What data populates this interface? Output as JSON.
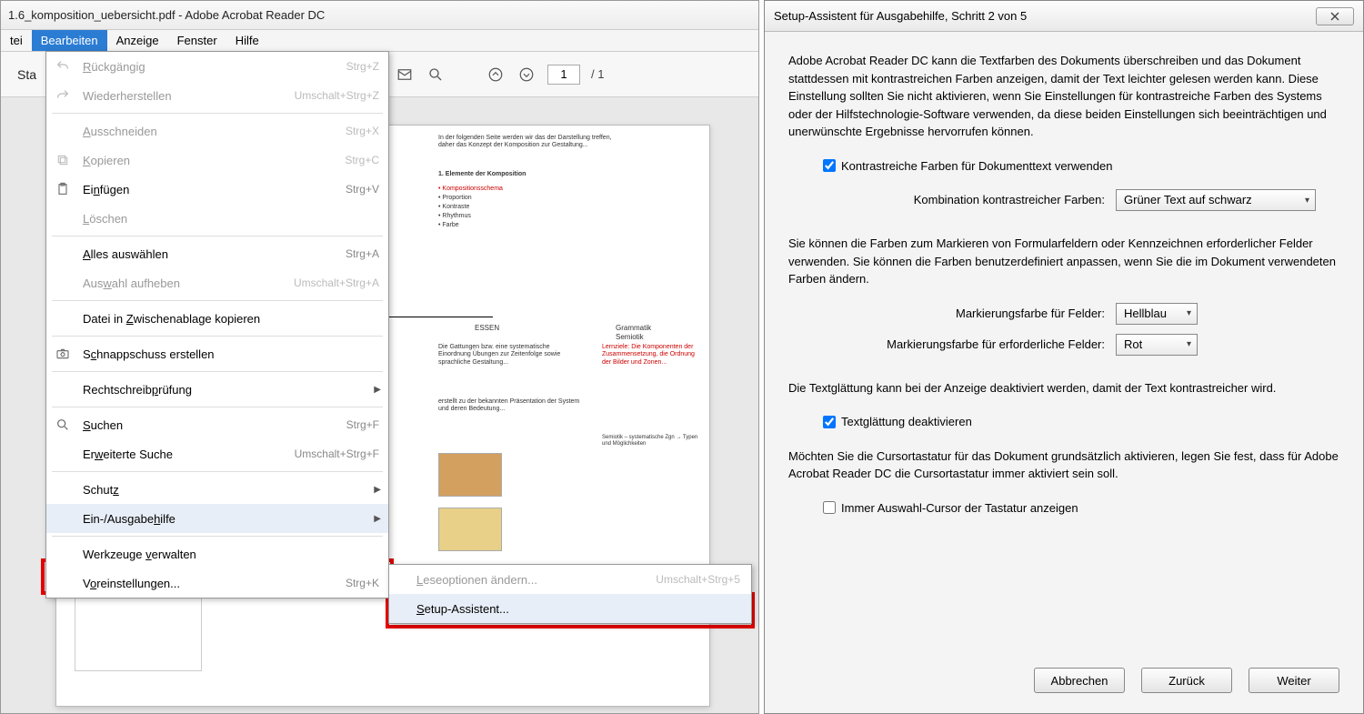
{
  "left": {
    "title": "1.6_komposition_uebersicht.pdf - Adobe Acrobat Reader DC",
    "menubar": {
      "file": "tei",
      "edit": "Bearbeiten",
      "view": "Anzeige",
      "window": "Fenster",
      "help": "Hilfe"
    },
    "toolbar": {
      "start_tab": "Sta",
      "page_value": "1",
      "page_total": "/ 1"
    },
    "dropdown": {
      "undo": "Rückgängig",
      "undo_sc": "Strg+Z",
      "redo": "Wiederherstellen",
      "redo_sc": "Umschalt+Strg+Z",
      "cut": "Ausschneiden",
      "cut_sc": "Strg+X",
      "copy": "Kopieren",
      "copy_sc": "Strg+C",
      "paste": "Einfügen",
      "paste_sc": "Strg+V",
      "delete": "Löschen",
      "selectall": "Alles auswählen",
      "selectall_sc": "Strg+A",
      "deselect": "Auswahl aufheben",
      "deselect_sc": "Umschalt+Strg+A",
      "copyclip": "Datei in Zwischenablage kopieren",
      "snapshot": "Schnappschuss erstellen",
      "spell": "Rechtschreibprüfung",
      "search": "Suchen",
      "search_sc": "Strg+F",
      "advsearch": "Erweiterte Suche",
      "advsearch_sc": "Umschalt+Strg+F",
      "protect": "Schutz",
      "accessibility": "Ein-/Ausgabehilfe",
      "tools": "Werkzeuge verwalten",
      "prefs": "Voreinstellungen...",
      "prefs_sc": "Strg+K"
    },
    "submenu": {
      "readopts": "Leseoptionen ändern...",
      "readopts_sc": "Umschalt+Strg+5",
      "setup": "Setup-Assistent..."
    }
  },
  "dialog": {
    "title": "Setup-Assistent für Ausgabehilfe, Schritt 2 von 5",
    "para1": "Adobe Acrobat Reader DC kann die Textfarben des Dokuments überschreiben und das Dokument stattdessen mit kontrastreichen Farben anzeigen, damit der Text leichter gelesen werden kann. Diese Einstellung sollten Sie nicht aktivieren, wenn Sie Einstellungen für kontrastreiche Farben des Systems oder der Hilfstechnologie-Software verwenden, da diese beiden Einstellungen sich beeinträchtigen und unerwünschte Ergebnisse hervorrufen können.",
    "check1": "Kontrastreiche Farben für Dokumenttext verwenden",
    "combo1_label": "Kombination kontrastreicher Farben:",
    "combo1_value": "Grüner Text auf schwarz",
    "para2": "Sie können die Farben zum Markieren von Formularfeldern oder Kennzeichnen erforderlicher Felder verwenden. Sie können die Farben benutzerdefiniert anpassen, wenn Sie die im Dokument verwendeten Farben ändern.",
    "field2_label": "Markierungsfarbe für Felder:",
    "field2_value": "Hellblau",
    "field3_label": "Markierungsfarbe für erforderliche Felder:",
    "field3_value": "Rot",
    "para3": "Die Textglättung kann bei der Anzeige deaktiviert werden, damit der Text kontrastreicher wird.",
    "check2": "Textglättung deaktivieren",
    "para4": "Möchten Sie die Cursortastatur für das Dokument grundsätzlich aktivieren, legen Sie fest, dass für Adobe Acrobat Reader DC die Cursortastatur immer aktiviert sein soll.",
    "check3": "Immer Auswahl-Cursor der Tastatur anzeigen",
    "btn_cancel": "Abbrechen",
    "btn_back": "Zurück",
    "btn_next": "Weiter"
  }
}
